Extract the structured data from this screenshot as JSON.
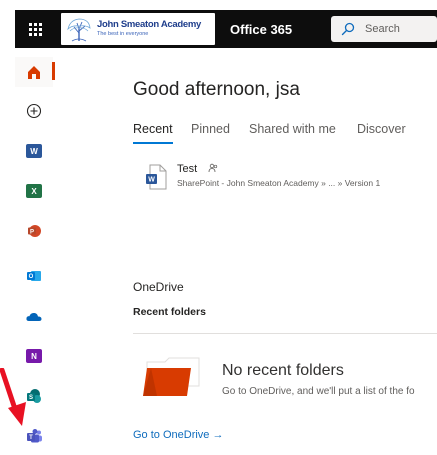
{
  "header": {
    "school_name": "John Smeaton Academy",
    "school_tagline": "The best in everyone",
    "app_title": "Office 365",
    "search_placeholder": "Search"
  },
  "rail": {
    "items": [
      {
        "name": "home",
        "icon": "home-icon",
        "color": "#d83b01"
      },
      {
        "name": "create",
        "icon": "plus-circle-icon",
        "color": "#252423"
      },
      {
        "name": "word",
        "icon": "word-icon",
        "color": "#2b579a"
      },
      {
        "name": "excel",
        "icon": "excel-icon",
        "color": "#217346"
      },
      {
        "name": "powerpoint",
        "icon": "powerpoint-icon",
        "color": "#d24726"
      },
      {
        "name": "outlook",
        "icon": "outlook-icon",
        "color": "#0078d4"
      },
      {
        "name": "onedrive",
        "icon": "onedrive-icon",
        "color": "#0364b8"
      },
      {
        "name": "onenote",
        "icon": "onenote-icon",
        "color": "#7719aa"
      },
      {
        "name": "sharepoint",
        "icon": "sharepoint-icon",
        "color": "#036c70"
      },
      {
        "name": "teams",
        "icon": "teams-icon",
        "color": "#5059c9"
      }
    ]
  },
  "main": {
    "greeting": "Good afternoon, jsa",
    "tabs": [
      {
        "label": "Recent",
        "active": true
      },
      {
        "label": "Pinned",
        "active": false
      },
      {
        "label": "Shared with me",
        "active": false
      },
      {
        "label": "Discover",
        "active": false
      }
    ],
    "recent_files": [
      {
        "name": "Test",
        "path": "SharePoint - John Smeaton Academy » ... » Version 1"
      }
    ],
    "onedrive": {
      "title": "OneDrive",
      "recent_folders_label": "Recent folders",
      "empty_title": "No recent folders",
      "empty_sub": "Go to OneDrive, and we'll put a list of the fo",
      "goto_label": "Go to OneDrive →"
    }
  },
  "colors": {
    "accent": "#0078d4",
    "header_bg": "#0d0d0d",
    "annotation_arrow": "#e81123"
  }
}
